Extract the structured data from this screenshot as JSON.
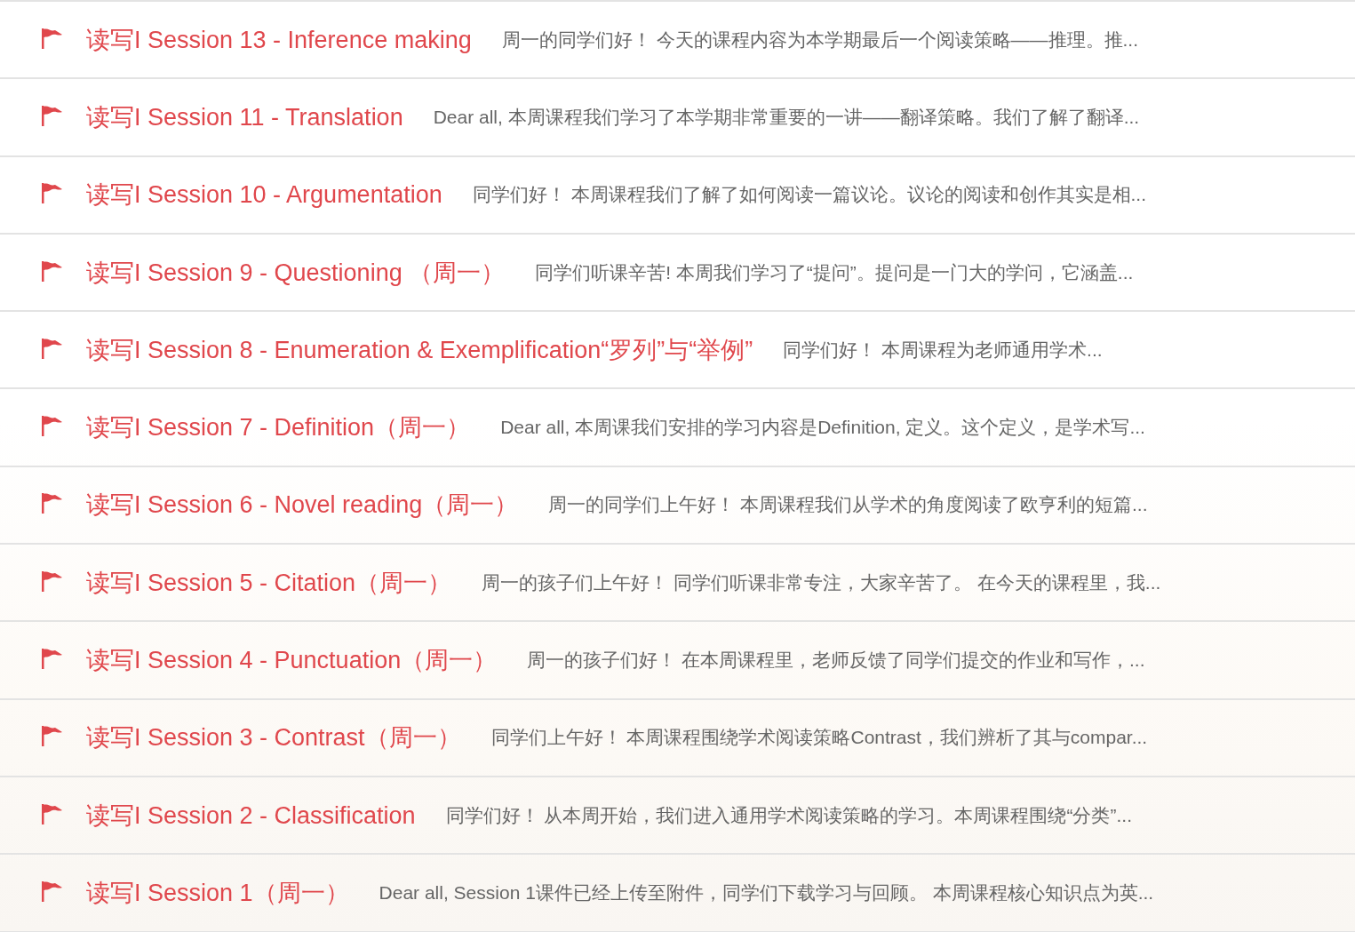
{
  "posts": [
    {
      "title": "读写I Session 13 - Inference making",
      "summary": "周一的同学们好！ 今天的课程内容为本学期最后一个阅读策略——推理。推..."
    },
    {
      "title": "读写I Session 11 - Translation",
      "summary": "Dear all, 本周课程我们学习了本学期非常重要的一讲——翻译策略。我们了解了翻译..."
    },
    {
      "title": "读写I Session 10 - Argumentation",
      "summary": "同学们好！ 本周课程我们了解了如何阅读一篇议论。议论的阅读和创作其实是相..."
    },
    {
      "title": "读写I Session 9 - Questioning （周一）",
      "summary": "同学们听课辛苦! 本周我们学习了“提问”。提问是一门大的学问，它涵盖..."
    },
    {
      "title": "读写I Session 8 - Enumeration & Exemplification“罗列”与“举例”",
      "summary": "同学们好！ 本周课程为老师通用学术..."
    },
    {
      "title": "读写I Session 7 - Definition（周一）",
      "summary": "Dear all, 本周课我们安排的学习内容是Definition, 定义。这个定义，是学术写..."
    },
    {
      "title": "读写I Session 6 - Novel reading（周一）",
      "summary": "周一的同学们上午好！ 本周课程我们从学术的角度阅读了欧亨利的短篇..."
    },
    {
      "title": "读写I Session 5 - Citation（周一）",
      "summary": "周一的孩子们上午好！ 同学们听课非常专注，大家辛苦了。 在今天的课程里，我..."
    },
    {
      "title": "读写I Session 4 - Punctuation（周一）",
      "summary": "周一的孩子们好！ 在本周课程里，老师反馈了同学们提交的作业和写作，..."
    },
    {
      "title": "读写I Session 3 - Contrast（周一）",
      "summary": "同学们上午好！ 本周课程围绕学术阅读策略Contrast，我们辨析了其与compar..."
    },
    {
      "title": "读写I Session 2 - Classification",
      "summary": "同学们好！ 从本周开始，我们进入通用学术阅读策略的学习。本周课程围绕“分类”..."
    },
    {
      "title": "读写I Session 1（周一）",
      "summary": "Dear all, Session 1课件已经上传至附件，同学们下载学习与回顾。 本周课程核心知识点为英..."
    }
  ]
}
